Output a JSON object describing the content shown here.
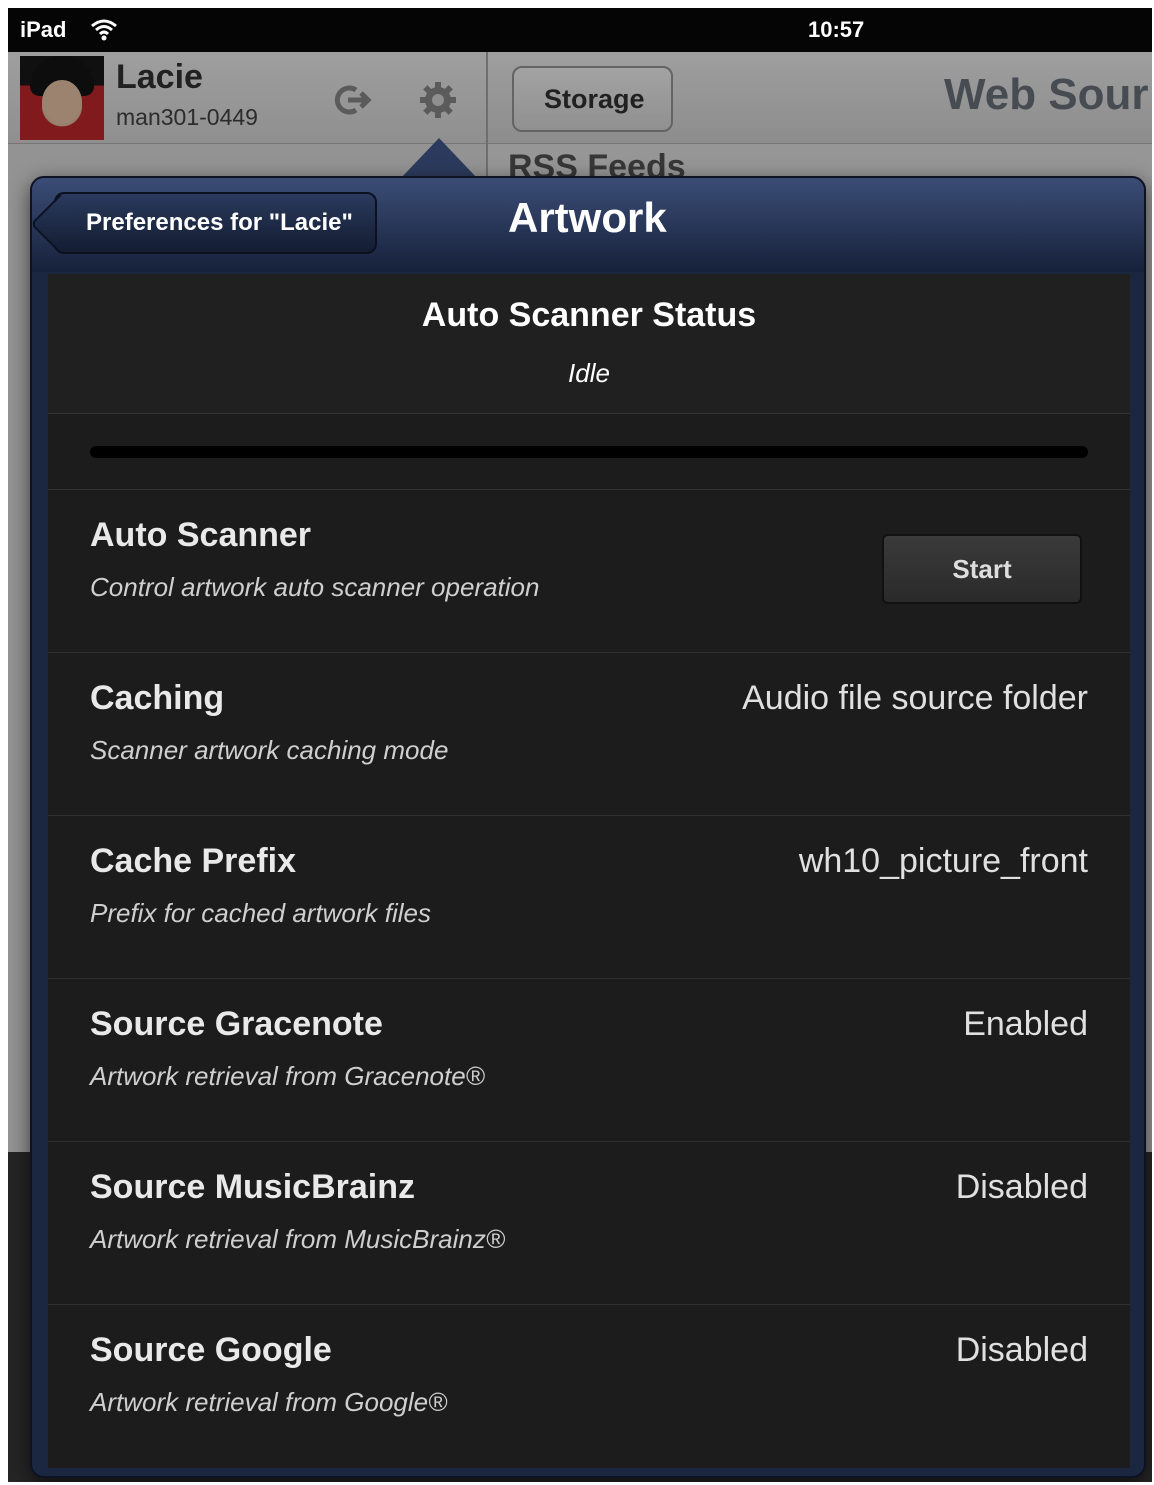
{
  "status_bar": {
    "carrier": "iPad",
    "time": "10:57"
  },
  "user": {
    "name": "Lacie",
    "id": "man301-0449"
  },
  "background": {
    "back_button": "Storage",
    "title": "Web Sour",
    "list_item": "RSS Feeds"
  },
  "popover": {
    "back_button": "Preferences for \"Lacie\"",
    "title": "Artwork",
    "status": {
      "title": "Auto Scanner Status",
      "value": "Idle",
      "progress": 0
    },
    "rows": [
      {
        "title": "Auto Scanner",
        "subtitle": "Control artwork auto scanner operation",
        "button": "Start"
      },
      {
        "title": "Caching",
        "subtitle": "Scanner artwork caching mode",
        "value": "Audio file source folder"
      },
      {
        "title": "Cache Prefix",
        "subtitle": "Prefix for cached artwork files",
        "value": "wh10_picture_front"
      },
      {
        "title": "Source Gracenote",
        "subtitle": "Artwork retrieval from Gracenote®",
        "value": "Enabled"
      },
      {
        "title": "Source MusicBrainz",
        "subtitle": "Artwork retrieval from MusicBrainz®",
        "value": "Disabled"
      },
      {
        "title": "Source Google",
        "subtitle": "Artwork retrieval from Google®",
        "value": "Disabled"
      }
    ]
  },
  "colors": {
    "nav_bar": "#2c3b5d",
    "row_bg": "#1c1c1c",
    "progress_fill": "#4a7bd0"
  },
  "icons": {
    "wifi": "wifi-icon",
    "logout": "logout-icon",
    "settings": "gear-icon"
  }
}
